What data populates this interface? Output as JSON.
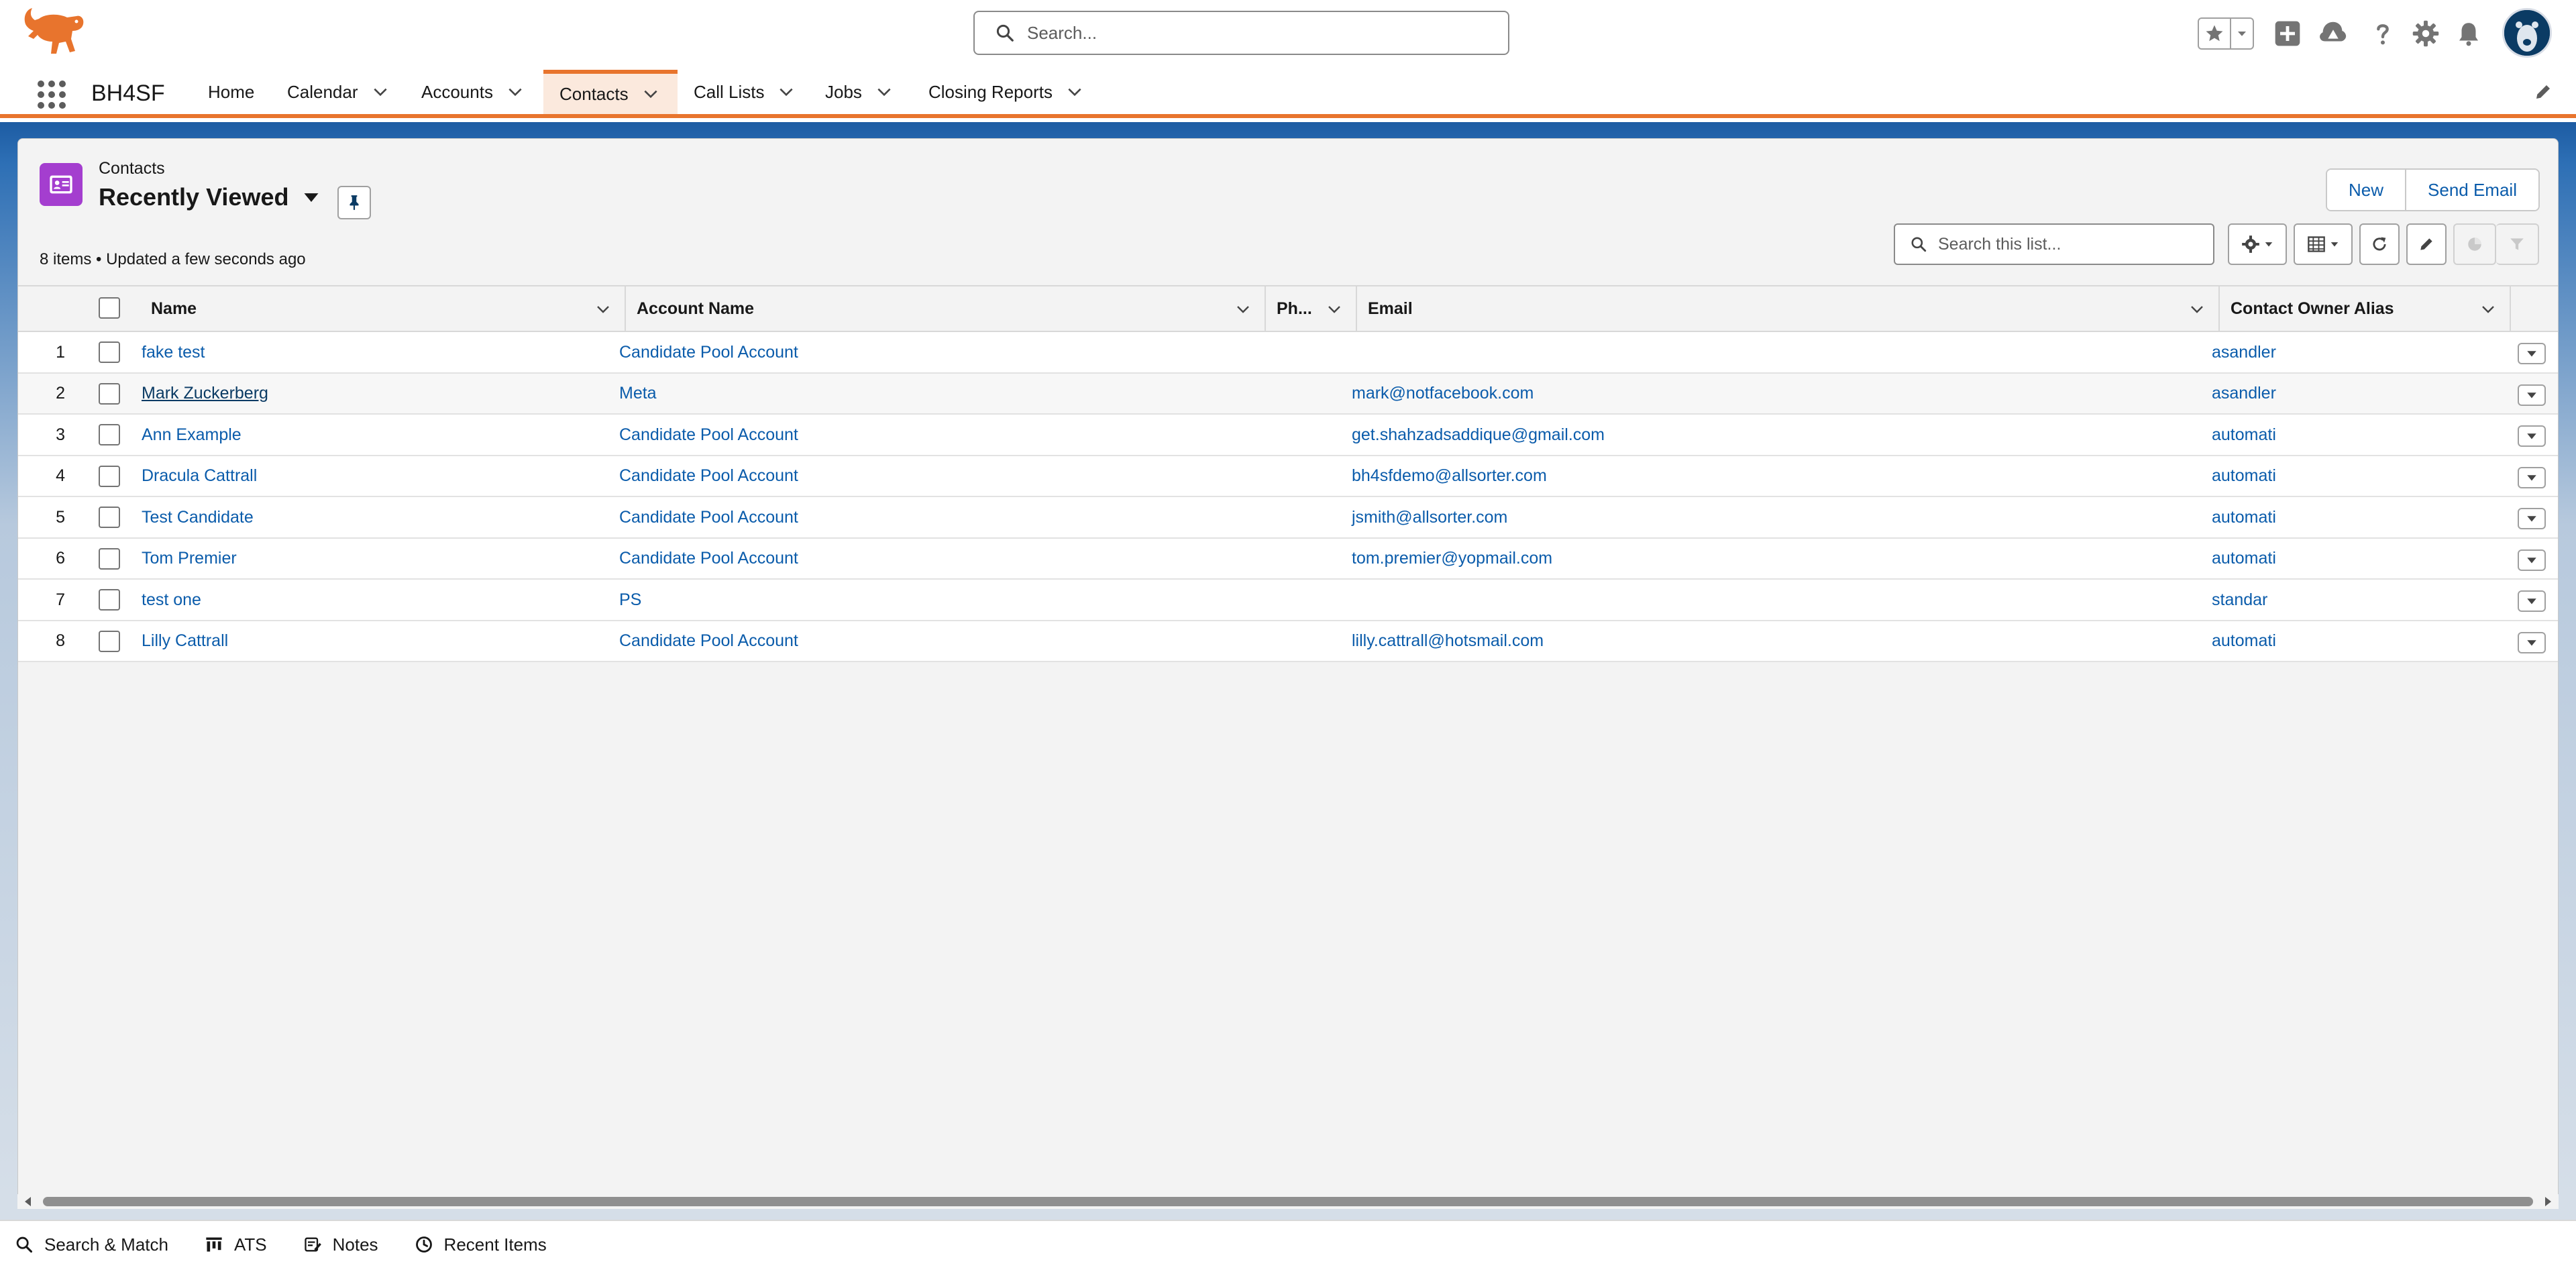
{
  "header": {
    "search_placeholder": "Search..."
  },
  "nav": {
    "app_name": "BH4SF",
    "items": [
      {
        "label": "Home"
      },
      {
        "label": "Calendar"
      },
      {
        "label": "Accounts"
      },
      {
        "label": "Contacts"
      },
      {
        "label": "Call Lists"
      },
      {
        "label": "Jobs"
      },
      {
        "label": "Closing Reports"
      }
    ],
    "active": "Contacts"
  },
  "list_view": {
    "object_label": "Contacts",
    "title": "Recently Viewed",
    "meta": "8 items • Updated a few seconds ago",
    "new_label": "New",
    "send_email_label": "Send Email",
    "search_placeholder": "Search this list..."
  },
  "table": {
    "columns": [
      "Name",
      "Account Name",
      "Ph...",
      "Email",
      "Contact Owner Alias"
    ],
    "rows": [
      {
        "num": "1",
        "name": "fake test",
        "account": "Candidate Pool Account",
        "phone": "",
        "email": "",
        "owner": "asandler"
      },
      {
        "num": "2",
        "name": "Mark Zuckerberg",
        "account": "Meta",
        "phone": "",
        "email": "mark@notfacebook.com",
        "owner": "asandler"
      },
      {
        "num": "3",
        "name": "Ann Example",
        "account": "Candidate Pool Account",
        "phone": "",
        "email": "get.shahzadsaddique@gmail.com",
        "owner": "automati"
      },
      {
        "num": "4",
        "name": "Dracula Cattrall",
        "account": "Candidate Pool Account",
        "phone": "",
        "email": "bh4sfdemo@allsorter.com",
        "owner": "automati"
      },
      {
        "num": "5",
        "name": "Test Candidate",
        "account": "Candidate Pool Account",
        "phone": "",
        "email": "jsmith@allsorter.com",
        "owner": "automati"
      },
      {
        "num": "6",
        "name": "Tom Premier",
        "account": "Candidate Pool Account",
        "phone": "",
        "email": "tom.premier@yopmail.com",
        "owner": "automati"
      },
      {
        "num": "7",
        "name": "test one",
        "account": "PS",
        "phone": "",
        "email": "",
        "owner": "standar"
      },
      {
        "num": "8",
        "name": "Lilly Cattrall",
        "account": "Candidate Pool Account",
        "phone": "",
        "email": "lilly.cattrall@hotsmail.com",
        "owner": "automati"
      }
    ]
  },
  "utility_bar": {
    "items": [
      {
        "label": "Search & Match",
        "icon": "search-icon"
      },
      {
        "label": "ATS",
        "icon": "kanban-icon"
      },
      {
        "label": "Notes",
        "icon": "notes-icon"
      },
      {
        "label": "Recent Items",
        "icon": "clock-icon"
      }
    ]
  },
  "colors": {
    "brand_orange": "#e8742d",
    "link_blue": "#0b5cab",
    "object_icon_purple": "#a43ecf",
    "header_blue": "#1d5ca3"
  }
}
